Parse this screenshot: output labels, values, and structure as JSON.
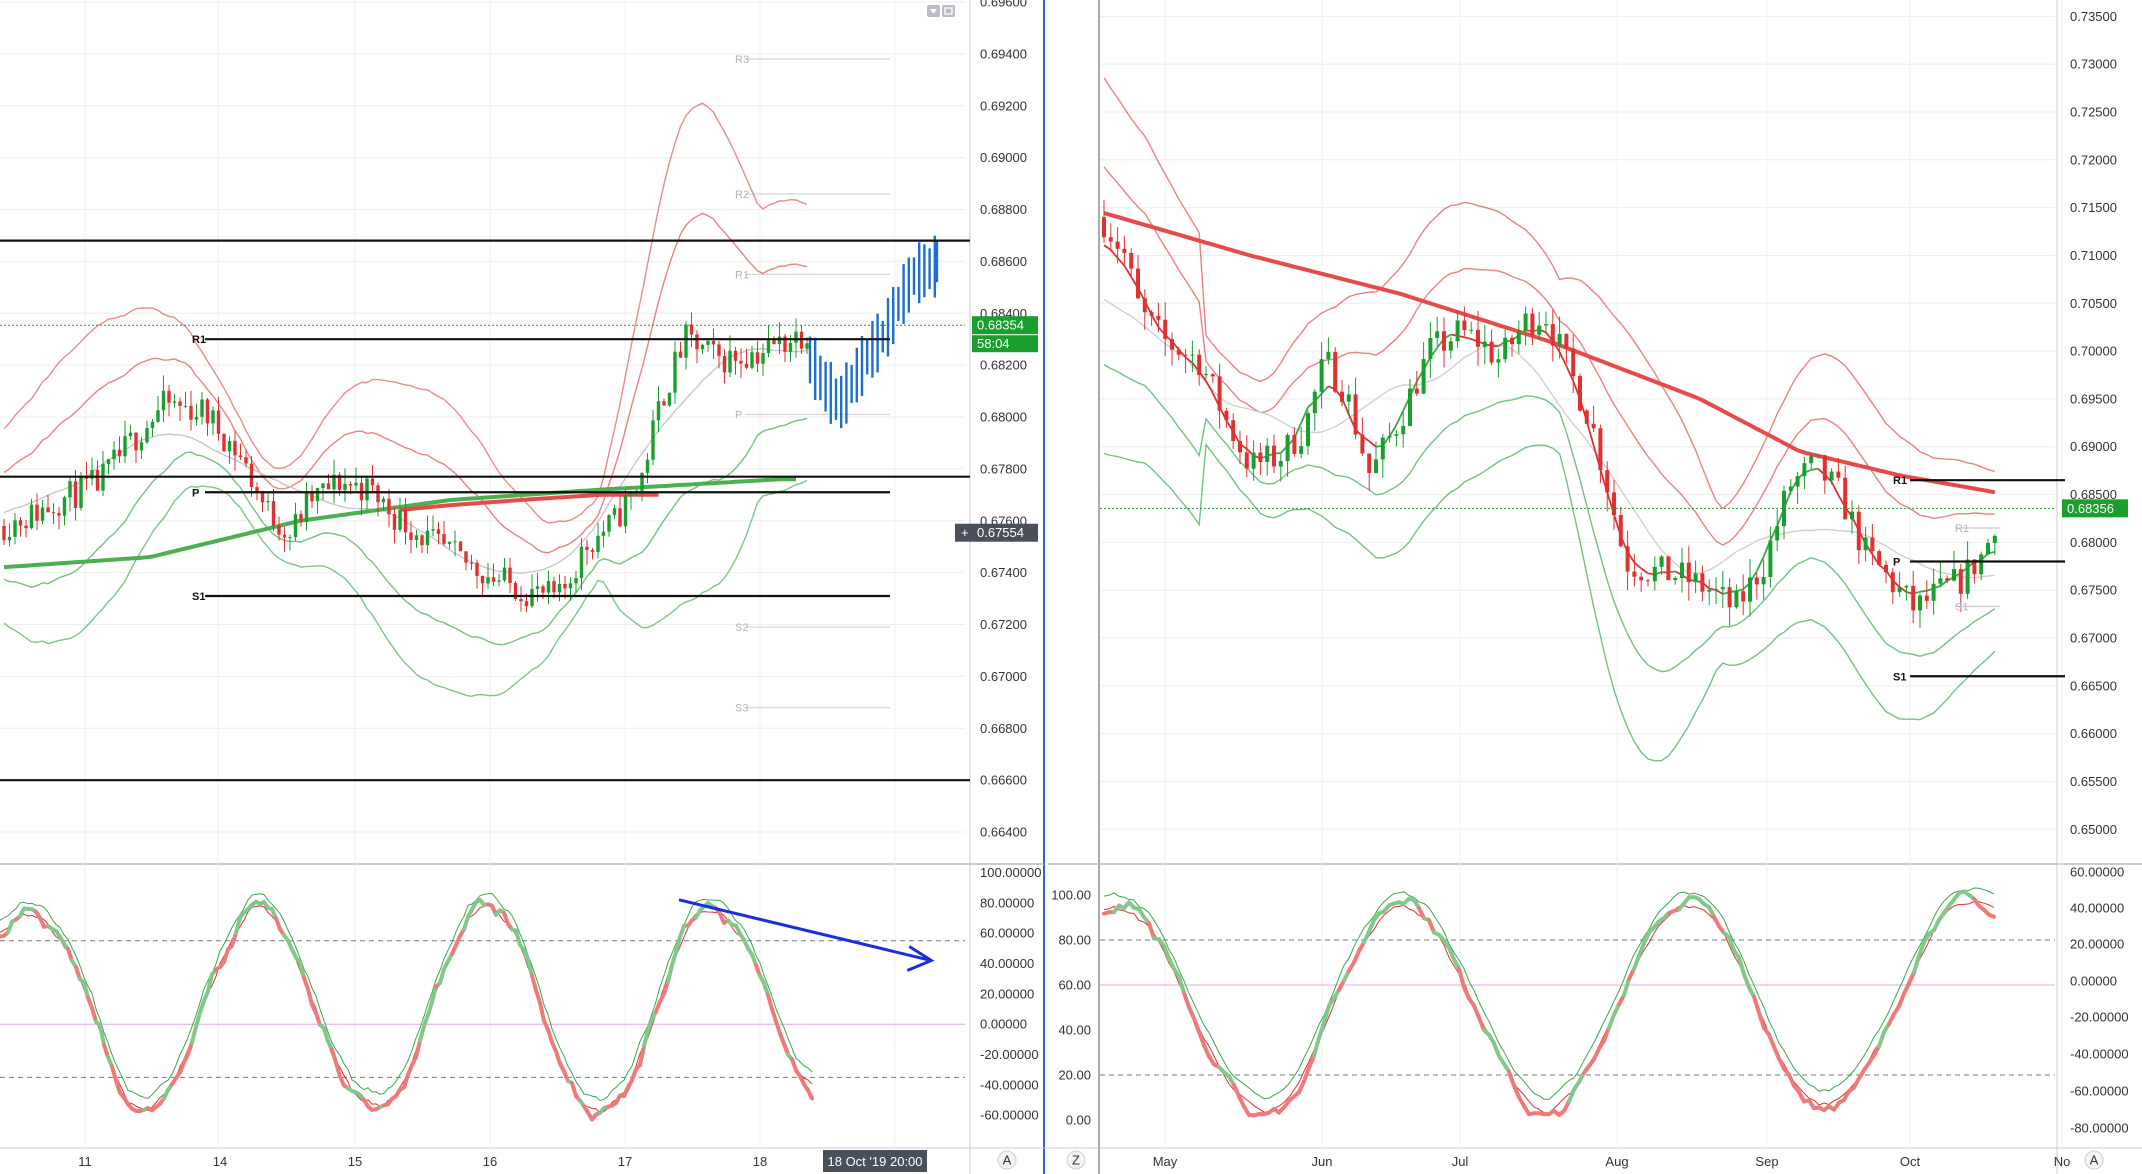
{
  "chart_data": [
    {
      "type": "candlestick",
      "name": "left-hourly-price",
      "price_axis": {
        "ylim": [
          0.663,
          0.696
        ],
        "ticks": [
          "0.69600",
          "0.69400",
          "0.69200",
          "0.69000",
          "0.68800",
          "0.68600",
          "0.68400",
          "0.68200",
          "0.68000",
          "0.67800",
          "0.67600",
          "0.67400",
          "0.67200",
          "0.67000",
          "0.66800",
          "0.66600",
          "0.66400"
        ]
      },
      "time_axis": {
        "labels": [
          "11",
          "14",
          "15",
          "16",
          "17",
          "18"
        ],
        "cursor_label": "18 Oct '19   20:00"
      },
      "current_price_tag": {
        "value": 0.68354,
        "label": "0.68354",
        "countdown": "58:04",
        "color": "#1a9e2e"
      },
      "crosshair_tag": {
        "value": 0.67554,
        "label": "0.67554"
      },
      "pivots": [
        {
          "label": "R3",
          "value": 0.6938
        },
        {
          "label": "R2",
          "value": 0.6886
        },
        {
          "label": "R1",
          "value": 0.6855
        },
        {
          "label": "P",
          "value": 0.6801
        },
        {
          "label": "S2",
          "value": 0.6719
        },
        {
          "label": "S3",
          "value": 0.6688
        }
      ],
      "black_levels": [
        {
          "label": "",
          "value": 0.6868
        },
        {
          "label": "R1",
          "value": 0.683
        },
        {
          "label": "",
          "value": 0.6777
        },
        {
          "label": "P",
          "value": 0.6771
        },
        {
          "label": "S1",
          "value": 0.6731
        },
        {
          "label": "",
          "value": 0.666
        }
      ],
      "projection_color": "#1f6fd1"
    },
    {
      "type": "oscillator",
      "name": "left-stochastic",
      "ylim": [
        -75,
        103
      ],
      "ticks": [
        "100.00000",
        "80.00000",
        "60.00000",
        "40.00000",
        "20.00000",
        "0.00000",
        "-20.00000",
        "-40.00000",
        "-60.00000"
      ],
      "levels": [
        55,
        -35
      ],
      "midline": 0,
      "trend_arrow": {
        "color": "#1a2ee0",
        "from": [
          0.6,
          82
        ],
        "to": [
          0.82,
          42
        ]
      }
    },
    {
      "type": "candlestick",
      "name": "right-daily-price",
      "price_axis": {
        "ylim": [
          0.647,
          0.7365
        ],
        "ticks": [
          "0.73500",
          "0.73000",
          "0.72500",
          "0.72000",
          "0.71500",
          "0.71000",
          "0.70500",
          "0.70000",
          "0.69500",
          "0.69000",
          "0.68500",
          "0.68000",
          "0.67500",
          "0.67000",
          "0.66500",
          "0.66000",
          "0.65500",
          "0.65000"
        ]
      },
      "time_axis": {
        "labels": [
          "May",
          "Jun",
          "Jul",
          "Aug",
          "Sep",
          "Oct",
          "No"
        ]
      },
      "current_price_tag": {
        "value": 0.68356,
        "label": "0.68356",
        "color": "#1a9e2e"
      },
      "black_levels": [
        {
          "label": "R1",
          "value": 0.6865
        },
        {
          "label": "P",
          "value": 0.678
        },
        {
          "label": "S1",
          "value": 0.666
        }
      ],
      "faint_levels": [
        {
          "label": "R1",
          "value": 0.6815
        },
        {
          "label": "S1",
          "value": 0.6733
        }
      ]
    },
    {
      "type": "oscillator",
      "name": "right-stochastic",
      "left_axis": {
        "ylim": [
          -8,
          112
        ],
        "ticks": [
          "100.00",
          "80.00",
          "60.00",
          "40.00",
          "20.00",
          "0.00"
        ]
      },
      "right_axis": {
        "ticks": [
          "60.00000",
          "40.00000",
          "20.00000",
          "0.00000",
          "-20.00000",
          "-40.00000",
          "-60.00000",
          "-80.00000"
        ]
      },
      "levels": [
        80,
        20
      ],
      "midline": 60
    }
  ],
  "ui": {
    "corner_letter_left": "A",
    "corner_letter_mid": "Z",
    "corner_letter_right": "A"
  }
}
